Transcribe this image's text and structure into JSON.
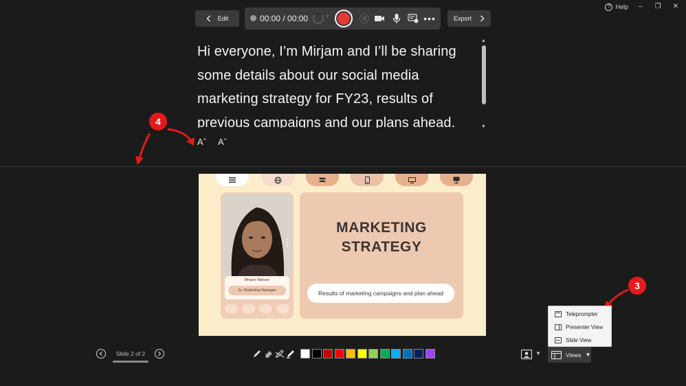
{
  "window": {
    "help_label": "Help",
    "minimize_glyph": "–",
    "restore_glyph": "❐",
    "close_glyph": "✕"
  },
  "toolbar": {
    "edit_label": "Edit",
    "timer": "00:00 / 00:00",
    "export_label": "Export"
  },
  "teleprompter": {
    "script_text": "Hi everyone, I’m Mirjam and I’ll be sharing some details about our social media marketing strategy for FY23, results of previous campaigns and our plans ahead.",
    "increase_font_label": "Aˆ",
    "decrease_font_label": "Aˇ"
  },
  "callouts": {
    "font_size": "4",
    "views_menu": "3"
  },
  "slide": {
    "title_line1": "MARKETING",
    "title_line2": "STRATEGY",
    "subtitle": "Results of marketing campaigns and plan ahead",
    "presenter_name": "Mirjam Nielson",
    "presenter_role": "Sr. Marketing Manager",
    "tab_icons": [
      "menu-icon",
      "globe-icon",
      "people-icon",
      "phone-icon",
      "monitor-icon",
      "presentation-icon"
    ]
  },
  "slide_nav": {
    "counter": "Slide 2 of 2"
  },
  "ink": {
    "tools": [
      "pen-icon",
      "eraser-icon",
      "highlighter-icon",
      "marker-icon"
    ],
    "colors": [
      "#ffffff",
      "#000000",
      "#c00000",
      "#ff0000",
      "#ffc000",
      "#ffff00",
      "#92d050",
      "#00b050",
      "#00b0f0",
      "#0070c0",
      "#002060",
      "#a040ff"
    ]
  },
  "views": {
    "button_label": "Views",
    "menu_items": [
      "Teleprompter",
      "Presenter View",
      "Slide View"
    ]
  },
  "accent": {
    "record": "#e53935",
    "callout": "#e31b1b"
  }
}
